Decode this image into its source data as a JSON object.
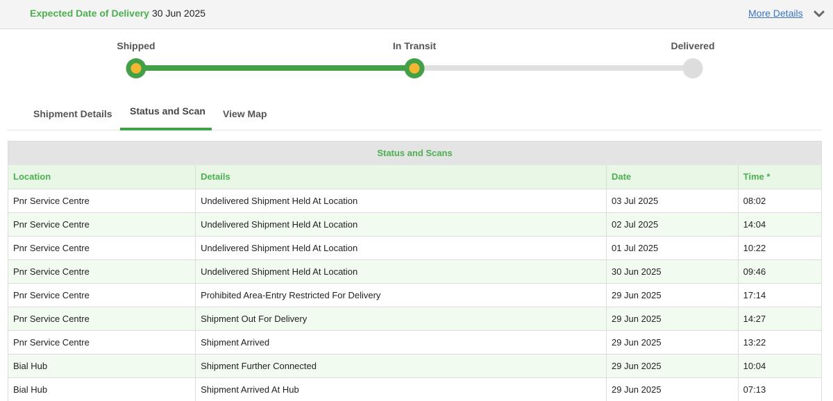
{
  "header": {
    "edd_label": "Expected Date of Delivery",
    "edd_value": "30 Jun 2025",
    "more_details": "More Details",
    "chevron_icon": "chevron-down-icon"
  },
  "progress": {
    "stages": [
      {
        "label": "Shipped",
        "status": "done"
      },
      {
        "label": "In Transit",
        "status": "done"
      },
      {
        "label": "Delivered",
        "status": "pending"
      }
    ],
    "colors": {
      "done": "#43a047",
      "current_dot": "#f5b731",
      "pending": "#dddddd"
    }
  },
  "tabs": [
    {
      "label": "Shipment Details",
      "active": false
    },
    {
      "label": "Status and Scan",
      "active": true
    },
    {
      "label": "View Map",
      "active": false
    }
  ],
  "scans": {
    "title": "Status and Scans",
    "columns": [
      "Location",
      "Details",
      "Date",
      "Time *"
    ],
    "rows": [
      [
        "Pnr Service Centre",
        "Undelivered Shipment Held At Location",
        "03 Jul 2025",
        "08:02"
      ],
      [
        "Pnr Service Centre",
        "Undelivered Shipment Held At Location",
        "02 Jul 2025",
        "14:04"
      ],
      [
        "Pnr Service Centre",
        "Undelivered Shipment Held At Location",
        "01 Jul 2025",
        "10:22"
      ],
      [
        "Pnr Service Centre",
        "Undelivered Shipment Held At Location",
        "30 Jun 2025",
        "09:46"
      ],
      [
        "Pnr Service Centre",
        "Prohibited Area-Entry Restricted For Delivery",
        "29 Jun 2025",
        "17:14"
      ],
      [
        "Pnr Service Centre",
        "Shipment Out For Delivery",
        "29 Jun 2025",
        "14:27"
      ],
      [
        "Pnr Service Centre",
        "Shipment Arrived",
        "29 Jun 2025",
        "13:22"
      ],
      [
        "Bial Hub",
        "Shipment Further Connected",
        "29 Jun 2025",
        "10:04"
      ],
      [
        "Bial Hub",
        "Shipment Arrived At Hub",
        "29 Jun 2025",
        "07:13"
      ]
    ]
  },
  "accent_color": "#4caf50"
}
